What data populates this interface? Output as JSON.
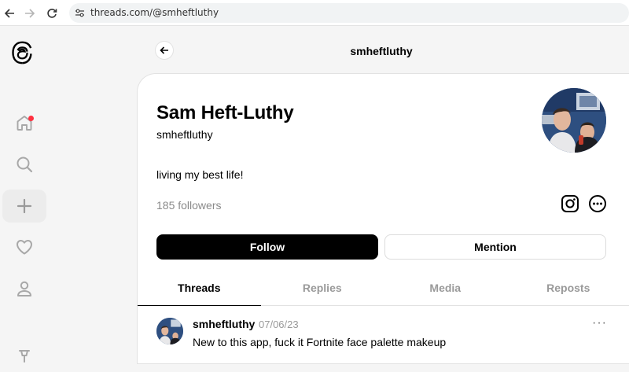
{
  "browser": {
    "url": "threads.com/@smheftluthy"
  },
  "rail": {
    "items": [
      {
        "name": "home",
        "active": false,
        "badge": true
      },
      {
        "name": "search",
        "active": false
      },
      {
        "name": "create",
        "active": true
      },
      {
        "name": "activity",
        "active": false
      },
      {
        "name": "profile",
        "active": false
      },
      {
        "name": "pin",
        "active": false
      }
    ]
  },
  "header": {
    "title": "smheftluthy"
  },
  "profile": {
    "name": "Sam Heft-Luthy",
    "handle": "smheftluthy",
    "bio": "living my best life!",
    "followers": "185 followers",
    "follow_label": "Follow",
    "mention_label": "Mention"
  },
  "tabs": [
    {
      "label": "Threads",
      "active": true
    },
    {
      "label": "Replies",
      "active": false
    },
    {
      "label": "Media",
      "active": false
    },
    {
      "label": "Reposts",
      "active": false
    }
  ],
  "post": {
    "author": "smheftluthy",
    "date": "07/06/23",
    "more": "···",
    "text": "New to this app, fuck it Fortnite face palette makeup"
  },
  "colors": {
    "accent": "#000000",
    "badge": "#ff3040",
    "muted": "#9a9a9a"
  }
}
